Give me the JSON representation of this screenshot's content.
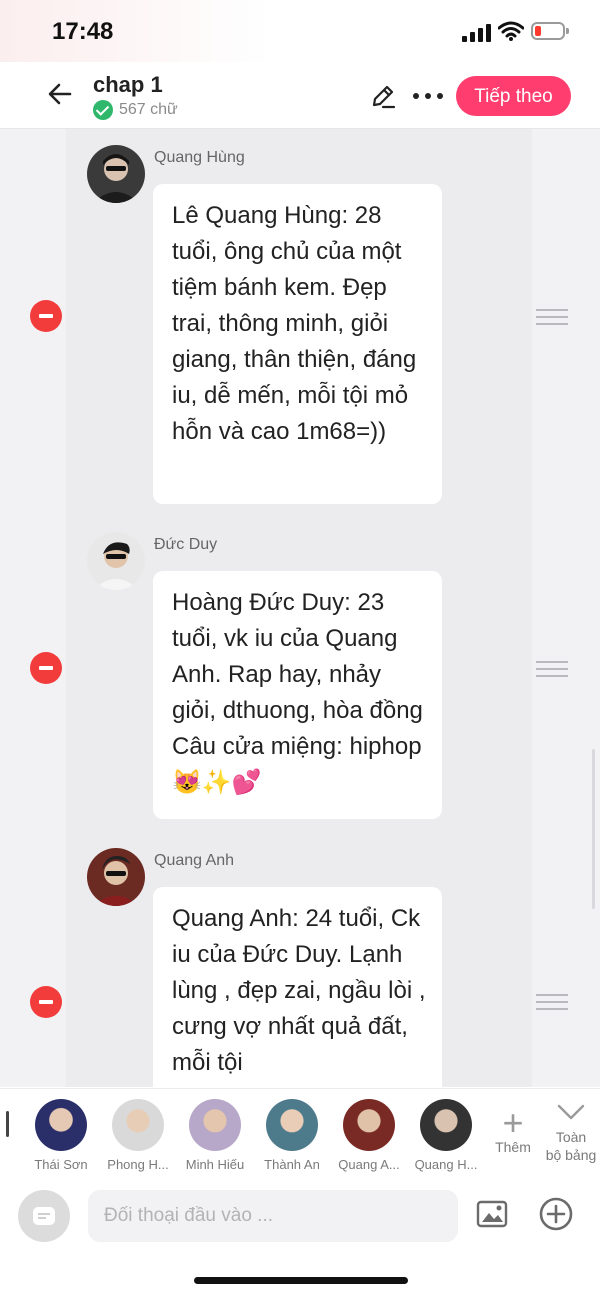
{
  "status_bar": {
    "time": "17:48"
  },
  "header": {
    "title": "chap 1",
    "word_count": "567 chữ",
    "next_label": "Tiếp theo"
  },
  "messages": [
    {
      "character": "Quang Hùng",
      "text": "Lê Quang Hùng: 28 tuổi, ông chủ của một tiệm bánh kem. Đẹp trai, thông minh, giỏi giang, thân thiện, đáng iu, dễ mến, mỗi tội mỏ hỗn và cao 1m68=))"
    },
    {
      "character": "Đức Duy",
      "text": "Hoàng Đức Duy: 23 tuổi, vk iu của Quang Anh. Rap hay, nhảy giỏi, dthuong, hòa đồng Câu cửa miệng: hiphop😻✨💕"
    },
    {
      "character": "Quang Anh",
      "text": "Quang Anh: 24 tuổi, Ck iu của Đức Duy. Lạnh lùng , đẹp zai, ngầu lòi , cưng vợ nhất quả đất, mỗi tội"
    }
  ],
  "character_strip": {
    "characters": [
      {
        "name": "Thái Sơn"
      },
      {
        "name": "Phong H..."
      },
      {
        "name": "Minh Hiếu"
      },
      {
        "name": "Thành An"
      },
      {
        "name": "Quang A..."
      },
      {
        "name": "Quang H..."
      }
    ],
    "add_label": "Thêm",
    "full_board_label_1": "Toàn",
    "full_board_label_2": "bộ bảng"
  },
  "input": {
    "placeholder": "Đối thoại đầu vào ..."
  },
  "colors": {
    "accent": "#ff3d6e",
    "remove": "#f23c3c",
    "success": "#2fb86b"
  },
  "icons": [
    "back-arrow-icon",
    "edit-pencil-icon",
    "more-dots-icon",
    "remove-icon",
    "drag-handle-icon",
    "plus-icon",
    "chevron-down-icon",
    "chat-icon",
    "image-icon",
    "add-circle-icon"
  ]
}
